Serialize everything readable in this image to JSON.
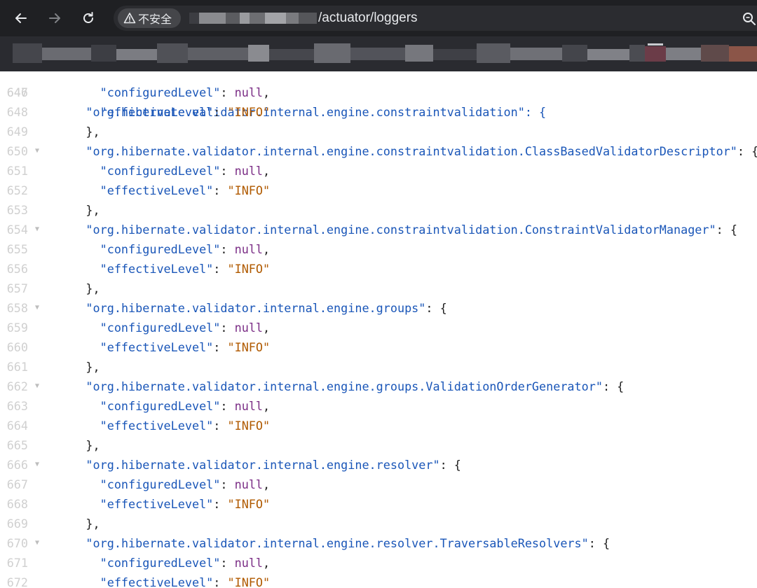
{
  "browser": {
    "security_label": "不安全",
    "url_path": "/actuator/loggers"
  },
  "viewer": {
    "first_partial_line": {
      "number": "646",
      "text": "\"org.hibernate.validator.internal.engine.constraintvalidation\": {"
    },
    "lines": [
      {
        "n": "647",
        "indent": 4,
        "parts": [
          [
            "str",
            "\"configuredLevel\""
          ],
          [
            "punc",
            ": "
          ],
          [
            "null",
            "null"
          ],
          [
            "punc",
            ","
          ]
        ]
      },
      {
        "n": "648",
        "indent": 4,
        "parts": [
          [
            "str",
            "\"effectiveLevel\""
          ],
          [
            "punc",
            ": "
          ],
          [
            "val",
            "\"INFO\""
          ]
        ]
      },
      {
        "n": "649",
        "indent": 2,
        "parts": [
          [
            "punc",
            "},"
          ]
        ]
      },
      {
        "n": "650",
        "fold": true,
        "indent": 2,
        "parts": [
          [
            "str",
            "\"org.hibernate.validator.internal.engine.constraintvalidation.ClassBasedValidatorDescriptor\""
          ],
          [
            "punc",
            ": {"
          ]
        ]
      },
      {
        "n": "651",
        "indent": 4,
        "parts": [
          [
            "str",
            "\"configuredLevel\""
          ],
          [
            "punc",
            ": "
          ],
          [
            "null",
            "null"
          ],
          [
            "punc",
            ","
          ]
        ]
      },
      {
        "n": "652",
        "indent": 4,
        "parts": [
          [
            "str",
            "\"effectiveLevel\""
          ],
          [
            "punc",
            ": "
          ],
          [
            "val",
            "\"INFO\""
          ]
        ]
      },
      {
        "n": "653",
        "indent": 2,
        "parts": [
          [
            "punc",
            "},"
          ]
        ]
      },
      {
        "n": "654",
        "fold": true,
        "indent": 2,
        "parts": [
          [
            "str",
            "\"org.hibernate.validator.internal.engine.constraintvalidation.ConstraintValidatorManager\""
          ],
          [
            "punc",
            ": {"
          ]
        ]
      },
      {
        "n": "655",
        "indent": 4,
        "parts": [
          [
            "str",
            "\"configuredLevel\""
          ],
          [
            "punc",
            ": "
          ],
          [
            "null",
            "null"
          ],
          [
            "punc",
            ","
          ]
        ]
      },
      {
        "n": "656",
        "indent": 4,
        "parts": [
          [
            "str",
            "\"effectiveLevel\""
          ],
          [
            "punc",
            ": "
          ],
          [
            "val",
            "\"INFO\""
          ]
        ]
      },
      {
        "n": "657",
        "indent": 2,
        "parts": [
          [
            "punc",
            "},"
          ]
        ]
      },
      {
        "n": "658",
        "fold": true,
        "indent": 2,
        "parts": [
          [
            "str",
            "\"org.hibernate.validator.internal.engine.groups\""
          ],
          [
            "punc",
            ": {"
          ]
        ]
      },
      {
        "n": "659",
        "indent": 4,
        "parts": [
          [
            "str",
            "\"configuredLevel\""
          ],
          [
            "punc",
            ": "
          ],
          [
            "null",
            "null"
          ],
          [
            "punc",
            ","
          ]
        ]
      },
      {
        "n": "660",
        "indent": 4,
        "parts": [
          [
            "str",
            "\"effectiveLevel\""
          ],
          [
            "punc",
            ": "
          ],
          [
            "val",
            "\"INFO\""
          ]
        ]
      },
      {
        "n": "661",
        "indent": 2,
        "parts": [
          [
            "punc",
            "},"
          ]
        ]
      },
      {
        "n": "662",
        "fold": true,
        "indent": 2,
        "parts": [
          [
            "str",
            "\"org.hibernate.validator.internal.engine.groups.ValidationOrderGenerator\""
          ],
          [
            "punc",
            ": {"
          ]
        ]
      },
      {
        "n": "663",
        "indent": 4,
        "parts": [
          [
            "str",
            "\"configuredLevel\""
          ],
          [
            "punc",
            ": "
          ],
          [
            "null",
            "null"
          ],
          [
            "punc",
            ","
          ]
        ]
      },
      {
        "n": "664",
        "indent": 4,
        "parts": [
          [
            "str",
            "\"effectiveLevel\""
          ],
          [
            "punc",
            ": "
          ],
          [
            "val",
            "\"INFO\""
          ]
        ]
      },
      {
        "n": "665",
        "indent": 2,
        "parts": [
          [
            "punc",
            "},"
          ]
        ]
      },
      {
        "n": "666",
        "fold": true,
        "indent": 2,
        "parts": [
          [
            "str",
            "\"org.hibernate.validator.internal.engine.resolver\""
          ],
          [
            "punc",
            ": {"
          ]
        ]
      },
      {
        "n": "667",
        "indent": 4,
        "parts": [
          [
            "str",
            "\"configuredLevel\""
          ],
          [
            "punc",
            ": "
          ],
          [
            "null",
            "null"
          ],
          [
            "punc",
            ","
          ]
        ]
      },
      {
        "n": "668",
        "indent": 4,
        "parts": [
          [
            "str",
            "\"effectiveLevel\""
          ],
          [
            "punc",
            ": "
          ],
          [
            "val",
            "\"INFO\""
          ]
        ]
      },
      {
        "n": "669",
        "indent": 2,
        "parts": [
          [
            "punc",
            "},"
          ]
        ]
      },
      {
        "n": "670",
        "fold": true,
        "indent": 2,
        "parts": [
          [
            "str",
            "\"org.hibernate.validator.internal.engine.resolver.TraversableResolvers\""
          ],
          [
            "punc",
            ": {"
          ]
        ]
      },
      {
        "n": "671",
        "indent": 4,
        "parts": [
          [
            "str",
            "\"configuredLevel\""
          ],
          [
            "punc",
            ": "
          ],
          [
            "null",
            "null"
          ],
          [
            "punc",
            ","
          ]
        ]
      },
      {
        "n": "672",
        "indent": 4,
        "parts": [
          [
            "str",
            "\"effectiveLevel\""
          ],
          [
            "punc",
            ": "
          ],
          [
            "val",
            "\"INFO\""
          ]
        ]
      }
    ]
  }
}
